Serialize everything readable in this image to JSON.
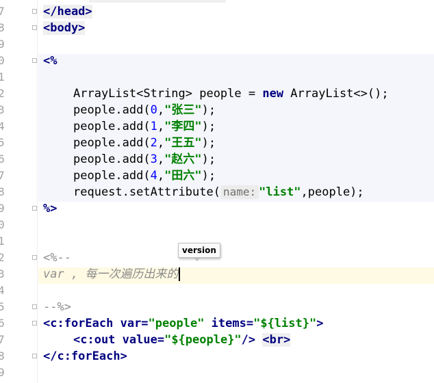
{
  "editor": {
    "line_numbers": [
      "7",
      "8",
      "9",
      "0",
      "1",
      "2",
      "3",
      "4",
      "5",
      "6",
      "7",
      "8",
      "9",
      "0",
      "1",
      "2",
      "3",
      "4",
      "5",
      "6",
      "7",
      "8",
      "9"
    ],
    "lines": {
      "l7": {
        "tag": "</head>"
      },
      "l8": {
        "tag": "<body>"
      },
      "l10": {
        "open": "<%"
      },
      "l12": {
        "t1": "ArrayList<String> people = ",
        "kw": "new",
        "t2": " ArrayList<>();"
      },
      "l13": {
        "a": "people.add(",
        "n": "0",
        "b": ",",
        "s": "\"张三\"",
        "c": ");"
      },
      "l14": {
        "a": "people.add(",
        "n": "1",
        "b": ",",
        "s": "\"李四\"",
        "c": ");"
      },
      "l15": {
        "a": "people.add(",
        "n": "2",
        "b": ",",
        "s": "\"王五\"",
        "c": ");"
      },
      "l16": {
        "a": "people.add(",
        "n": "3",
        "b": ",",
        "s": "\"赵六\"",
        "c": ");"
      },
      "l17": {
        "a": "people.add(",
        "n": "4",
        "b": ",",
        "s": "\"田六\"",
        "c": ");"
      },
      "l18": {
        "a": "request.setAttribute(",
        "hint": "name:",
        "s": "\"list\"",
        "c": ",people);"
      },
      "l19": {
        "close": "%>"
      },
      "l22": {
        "cmt": "<%--"
      },
      "l23": {
        "cmt": "var , 每一次遍历出来的"
      },
      "l25": {
        "cmt": "--%>"
      },
      "l26": {
        "tag_open": "<c:forEach",
        "attr1": " var=",
        "val1": "\"people\"",
        "attr2": " items=",
        "val2": "\"${list}\"",
        "end": ">"
      },
      "l27": {
        "tag_open": "<c:out",
        "attr1": " value=",
        "val1": "\"${people}\"",
        "end": "/>",
        "br": "<br>"
      },
      "l28": {
        "tag": "</c:forEach>"
      }
    }
  },
  "tooltip": {
    "text": "version"
  }
}
